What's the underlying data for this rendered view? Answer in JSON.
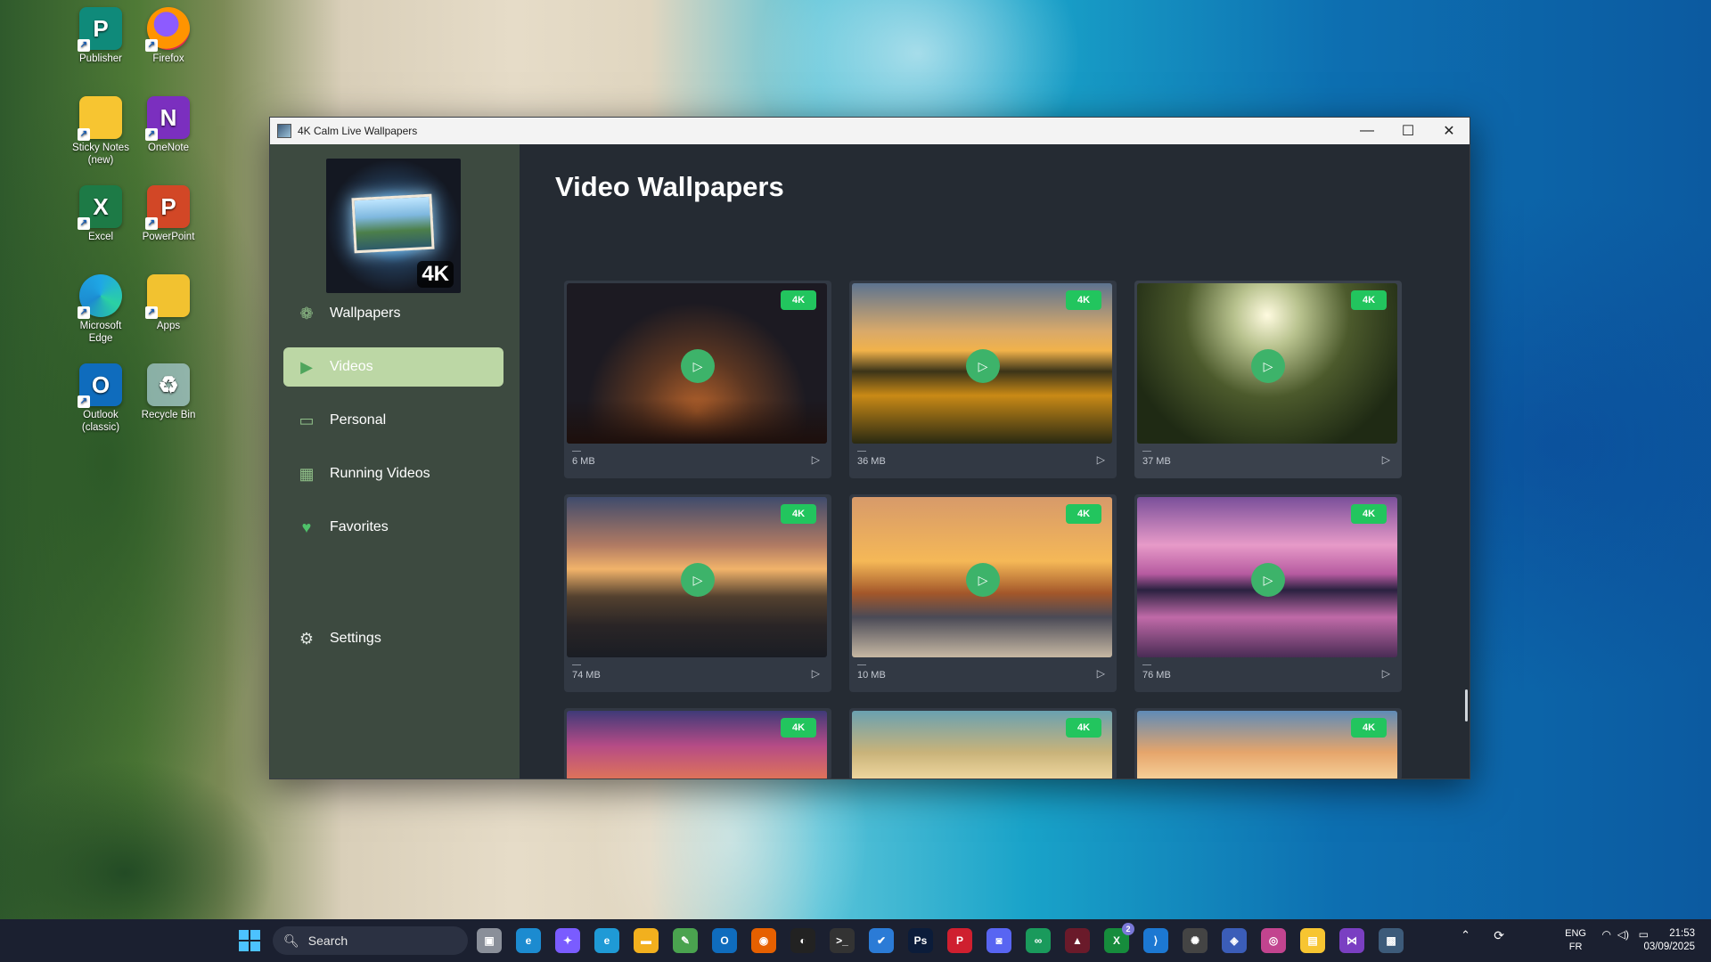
{
  "desktop": {
    "icons": [
      {
        "label": "Publisher",
        "glyph": "P",
        "color": "#0f8a7a",
        "icon": "publisher-icon"
      },
      {
        "label": "Firefox",
        "glyph": "",
        "color": "#e66000",
        "icon": "firefox-icon"
      },
      {
        "label": "Sticky Notes\n(new)",
        "glyph": "",
        "color": "#f7c531",
        "icon": "sticky-notes-icon"
      },
      {
        "label": "OneNote",
        "glyph": "N",
        "color": "#7b2fbf",
        "icon": "onenote-icon"
      },
      {
        "label": "Excel",
        "glyph": "X",
        "color": "#1d7a46",
        "icon": "excel-icon"
      },
      {
        "label": "PowerPoint",
        "glyph": "P",
        "color": "#d24726",
        "icon": "powerpoint-icon"
      },
      {
        "label": "Microsoft\nEdge",
        "glyph": "",
        "color": "#1c8bd0",
        "icon": "edge-icon"
      },
      {
        "label": "Apps",
        "glyph": "",
        "color": "#f2c230",
        "icon": "apps-folder-icon"
      },
      {
        "label": "Outlook\n(classic)",
        "glyph": "O",
        "color": "#0f6cbd",
        "icon": "outlook-icon"
      },
      {
        "label": "Recycle Bin",
        "glyph": "♻",
        "color": "#6cb8e6",
        "icon": "recycle-bin-icon"
      }
    ]
  },
  "window": {
    "title": "4K Calm Live Wallpapers",
    "controls": {
      "minimize": "—",
      "maximize": "☐",
      "close": "✕"
    }
  },
  "logo": {
    "badge": "4K"
  },
  "sidebar": {
    "items": [
      {
        "label": "Wallpapers",
        "icon": "wallpapers-icon",
        "glyph": "❁",
        "active": false
      },
      {
        "label": "Videos",
        "icon": "play-icon",
        "glyph": "▶",
        "active": true
      },
      {
        "label": "Personal",
        "icon": "folder-icon",
        "glyph": "▭",
        "active": false
      },
      {
        "label": "Running Videos",
        "icon": "grid-icon",
        "glyph": "▦",
        "active": false
      },
      {
        "label": "Favorites",
        "icon": "heart-icon",
        "glyph": "♥",
        "active": false
      }
    ],
    "settings": {
      "label": "Settings",
      "icon": "gear-icon",
      "glyph": "⚙"
    }
  },
  "main": {
    "title": "Video Wallpapers",
    "videos": [
      {
        "badge": "4K",
        "size": "6 MB",
        "theme": "t1"
      },
      {
        "badge": "4K",
        "size": "36 MB",
        "theme": "t2"
      },
      {
        "badge": "4K",
        "size": "37 MB",
        "theme": "t3"
      },
      {
        "badge": "4K",
        "size": "74 MB",
        "theme": "t4"
      },
      {
        "badge": "4K",
        "size": "10 MB",
        "theme": "t5"
      },
      {
        "badge": "4K",
        "size": "76 MB",
        "theme": "t6"
      },
      {
        "badge": "4K",
        "size": "",
        "theme": "t7"
      },
      {
        "badge": "4K",
        "size": "",
        "theme": "t8"
      },
      {
        "badge": "4K",
        "size": "",
        "theme": "t9"
      }
    ]
  },
  "taskbar": {
    "search_placeholder": "Search",
    "apps": [
      {
        "name": "task-view-icon",
        "color": "#8a8f99",
        "glyph": "▣"
      },
      {
        "name": "edge-icon",
        "color": "#1c8bd0",
        "glyph": "e"
      },
      {
        "name": "copilot-icon",
        "color": "#7a5cff",
        "glyph": "✦"
      },
      {
        "name": "edge-dev-icon",
        "color": "#1f9ad6",
        "glyph": "e"
      },
      {
        "name": "file-explorer-icon",
        "color": "#f2b01e",
        "glyph": "▬"
      },
      {
        "name": "notepad-icon",
        "color": "#4aa34f",
        "glyph": "✎"
      },
      {
        "name": "outlook-icon",
        "color": "#0f6cbd",
        "glyph": "O"
      },
      {
        "name": "firefox-icon",
        "color": "#e66000",
        "glyph": "◉"
      },
      {
        "name": "app-icon",
        "color": "#222",
        "glyph": "◐"
      },
      {
        "name": "terminal-icon",
        "color": "#333",
        "glyph": ">_"
      },
      {
        "name": "todo-icon",
        "color": "#2b7bd6",
        "glyph": "✔"
      },
      {
        "name": "photoshop-icon",
        "color": "#0b1c3a",
        "glyph": "Ps"
      },
      {
        "name": "pinterest-icon",
        "color": "#cf1f2f",
        "glyph": "P"
      },
      {
        "name": "discord-icon",
        "color": "#5865f2",
        "glyph": "◙"
      },
      {
        "name": "app-green-icon",
        "color": "#1a9a5c",
        "glyph": "∞"
      },
      {
        "name": "app-red-icon",
        "color": "#6a1a2a",
        "glyph": "▲"
      },
      {
        "name": "xbox-icon",
        "color": "#168c3c",
        "glyph": "X"
      },
      {
        "name": "vscode-icon",
        "color": "#1c78d2",
        "glyph": "⟩"
      },
      {
        "name": "chatgpt-icon",
        "color": "#444",
        "glyph": "✺"
      },
      {
        "name": "app-blue-icon",
        "color": "#3b5db8",
        "glyph": "◈"
      },
      {
        "name": "app-pink-icon",
        "color": "#c2448f",
        "glyph": "◎"
      },
      {
        "name": "sticky-notes-icon",
        "color": "#f7c531",
        "glyph": "▤"
      },
      {
        "name": "visual-studio-icon",
        "color": "#7a3fc2",
        "glyph": "⋈"
      },
      {
        "name": "wallpapers-app-icon",
        "color": "#3d5b7a",
        "glyph": "▩"
      }
    ],
    "xbox_badge": "2",
    "lang_top": "ENG",
    "lang_bottom": "FR",
    "time": "21:53",
    "date": "03/09/2025"
  }
}
